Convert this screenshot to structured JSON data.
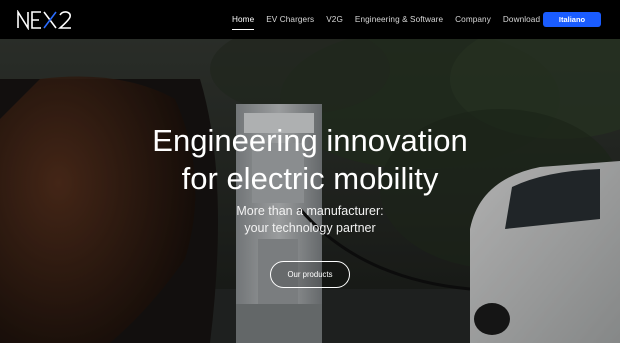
{
  "brand": {
    "logo_text": "NEX2"
  },
  "nav": {
    "items": [
      {
        "label": "Home",
        "active": true
      },
      {
        "label": "EV Chargers",
        "active": false
      },
      {
        "label": "V2G",
        "active": false
      },
      {
        "label": "Engineering & Software",
        "active": false
      },
      {
        "label": "Company",
        "active": false
      },
      {
        "label": "Download",
        "active": false
      }
    ],
    "language_button": "Italiano"
  },
  "hero": {
    "title_line1": "Engineering innovation",
    "title_line2": "for electric mobility",
    "subtitle_line1": "More than a manufacturer:",
    "subtitle_line2": "your technology partner",
    "cta_label": "Our products"
  },
  "colors": {
    "navbar_bg": "#000000",
    "accent": "#1a5cff",
    "text": "#ffffff"
  }
}
